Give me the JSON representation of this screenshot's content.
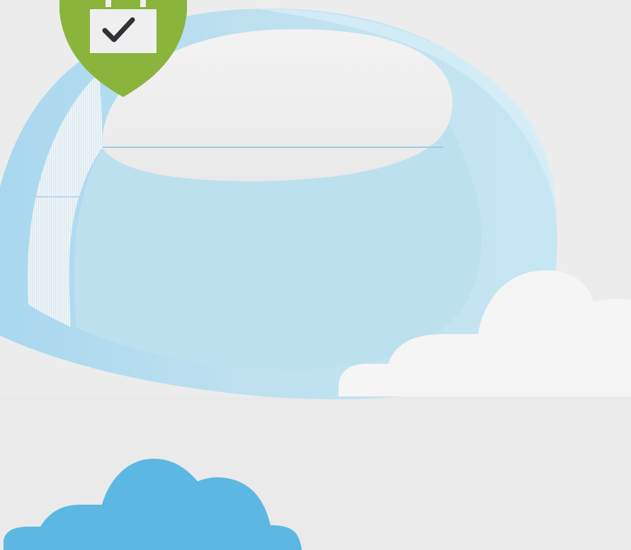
{
  "scene": {
    "colors": {
      "background": "#ebebeb",
      "dome": "#bfe0ef",
      "dome_light": "#d7edf6",
      "dome_dark": "#a8d3ea",
      "cloud_white": "#f5f5f5",
      "cloud_blue": "#5cb8e2",
      "shield": "#8ab43c",
      "lock_body": "#efefef",
      "checkmark": "#2f3338"
    },
    "icons": {
      "security_badge": "shield-lock-check-icon",
      "right_cloud": "cloud-icon",
      "bottom_cloud": "cloud-icon"
    }
  }
}
